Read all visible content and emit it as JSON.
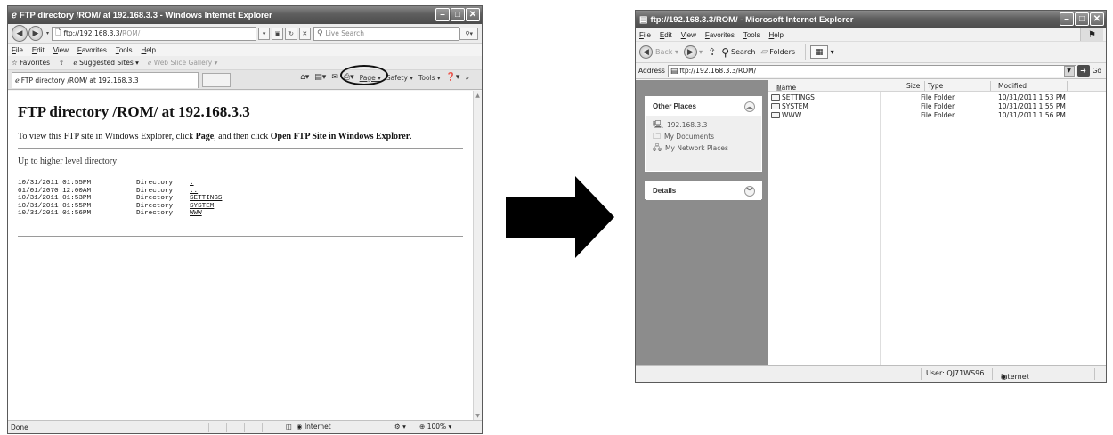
{
  "ie_window": {
    "title": "FTP directory /ROM/ at 192.168.3.3 - Windows Internet Explorer",
    "address_scheme": "ftp://192.168.3.3/",
    "address_path": "ROM/",
    "search_placeholder": "Live Search",
    "menu": [
      "File",
      "Edit",
      "View",
      "Favorites",
      "Tools",
      "Help"
    ],
    "favorites_label": "Favorites",
    "suggested_sites": "Suggested Sites ▾",
    "web_slice_gallery": "Web Slice Gallery ▾",
    "tab_title": "FTP directory /ROM/ at 192.168.3.3",
    "command_bar": {
      "page": "Page ▾",
      "safety": "Safety ▾",
      "tools": "Tools ▾"
    },
    "content": {
      "heading": "FTP directory /ROM/ at 192.168.3.3",
      "intro_1": "To view this FTP site in Windows Explorer, click ",
      "intro_page": "Page",
      "intro_2": ", and then click ",
      "intro_open": "Open FTP Site in Windows Explorer",
      "intro_3": ".",
      "up_link": "Up to higher level directory",
      "listing": [
        {
          "date": "10/31/2011 01:55PM",
          "type": "Directory",
          "name": "."
        },
        {
          "date": "01/01/2070 12:00AM",
          "type": "Directory",
          "name": ".."
        },
        {
          "date": "10/31/2011 01:53PM",
          "type": "Directory",
          "name": "SETTINGS"
        },
        {
          "date": "10/31/2011 01:55PM",
          "type": "Directory",
          "name": "SYSTEM"
        },
        {
          "date": "10/31/2011 01:56PM",
          "type": "Directory",
          "name": "WWW"
        }
      ]
    },
    "status": {
      "left": "Done",
      "zone": "Internet",
      "zoom": "100%"
    }
  },
  "explorer_window": {
    "title": "ftp://192.168.3.3/ROM/ - Microsoft Internet Explorer",
    "menu": [
      "File",
      "Edit",
      "View",
      "Favorites",
      "Tools",
      "Help"
    ],
    "toolbar": {
      "back": "Back",
      "search": "Search",
      "folders": "Folders"
    },
    "address_label": "Address",
    "address_value": "ftp://192.168.3.3/ROM/",
    "go_label": "Go",
    "other_places": {
      "title": "Other Places",
      "items": [
        "192.168.3.3",
        "My Documents",
        "My Network Places"
      ]
    },
    "details_title": "Details",
    "columns": {
      "name": "Name",
      "size": "Size",
      "type": "Type",
      "modified": "Modified"
    },
    "files": [
      {
        "name": "SETTINGS",
        "type": "File Folder",
        "modified": "10/31/2011 1:53 PM"
      },
      {
        "name": "SYSTEM",
        "type": "File Folder",
        "modified": "10/31/2011 1:55 PM"
      },
      {
        "name": "WWW",
        "type": "File Folder",
        "modified": "10/31/2011 1:56 PM"
      }
    ],
    "status": {
      "user": "User: QJ71WS96",
      "zone": "Internet"
    }
  },
  "icons": [
    "back-icon",
    "forward-icon",
    "refresh-icon",
    "stop-icon",
    "search-icon",
    "home-icon",
    "print-icon",
    "help-icon",
    "folder-icon",
    "globe-icon",
    "computer-icon",
    "arrow-icon"
  ]
}
